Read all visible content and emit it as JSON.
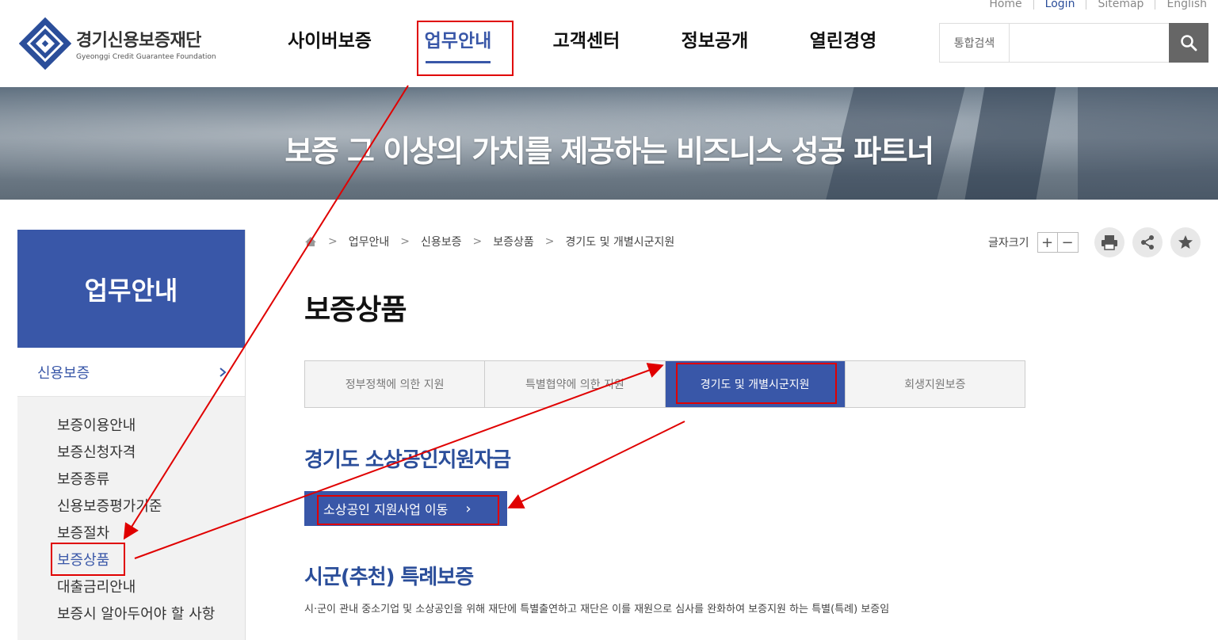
{
  "util_links": [
    "Home",
    "Login",
    "Sitemap",
    "English"
  ],
  "logo": {
    "title": "경기신용보증재단",
    "subtitle": "Gyeonggi Credit Guarantee Foundation"
  },
  "gnb": [
    "사이버보증",
    "업무안내",
    "고객센터",
    "정보공개",
    "열린경영"
  ],
  "search": {
    "label": "통합검색",
    "value": ""
  },
  "banner": {
    "title": "보증 그 이상의 가치를 제공하는 비즈니스 성공 파트너"
  },
  "sidebar": {
    "title": "업무안내",
    "category": "신용보증",
    "items": [
      "보증이용안내",
      "보증신청자격",
      "보증종류",
      "신용보증평가기준",
      "보증절차",
      "보증상품",
      "대출금리안내",
      "보증시 알아두어야 할 사항"
    ]
  },
  "breadcrumb": [
    "업무안내",
    "신용보증",
    "보증상품",
    "경기도 및 개별시군지원"
  ],
  "tools": {
    "font_size_label": "글자크기",
    "plus": "+",
    "minus": "−"
  },
  "page_title": "보증상품",
  "tabs": [
    "정부정책에 의한 지원",
    "특별협약에 의한 지원",
    "경기도 및 개별시군지원",
    "회생지원보증"
  ],
  "section1": {
    "title": "경기도 소상공인지원자금",
    "button": "소상공인 지원사업 이동"
  },
  "section2": {
    "title": "시군(추천) 특례보증",
    "desc": "시·군이 관내 중소기업 및 소상공인을 위해 재단에 특별출연하고 재단은 이를 재원으로 심사를 완화하여 보증지원 하는 특별(특례) 보증임"
  },
  "colors": {
    "brand": "#3957a8",
    "annotation": "#e00000"
  }
}
